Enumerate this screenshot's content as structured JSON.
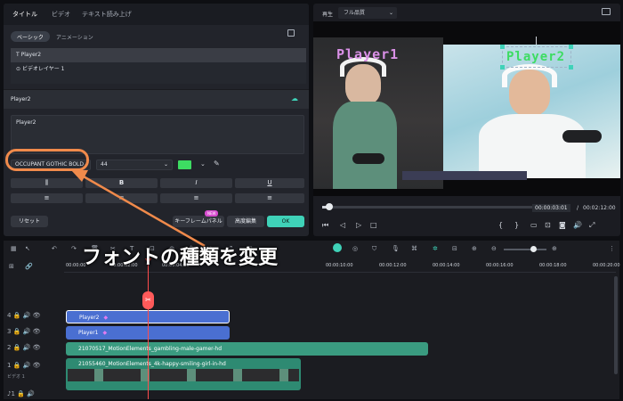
{
  "left_panel": {
    "tabs": [
      "タイトル",
      "ビデオ",
      "テキスト読み上げ"
    ],
    "subtabs": [
      "ベーシック",
      "アニメーション"
    ],
    "layers": [
      "Player2",
      "ビデオレイヤー 1"
    ],
    "section_title": "Player2",
    "text_value": "Player2",
    "font_name": "OCCUPANT GOTHIC BOLD",
    "font_size": "44",
    "format_buttons": [
      "B",
      "I",
      "U"
    ],
    "reset_label": "リセット",
    "keyframe_label": "キーフレームパネル",
    "keyframe_badge": "NEW",
    "advanced_label": "高度編集",
    "ok_label": "OK"
  },
  "preview": {
    "play_label": "再生",
    "quality_label": "フル品質",
    "overlay_left": "Player1",
    "overlay_right": "Player2",
    "current_time": "00:00:03:01",
    "separator": "/",
    "total_time": "00:02:12:00"
  },
  "timeline": {
    "ruler": [
      "00:00:00",
      "00:00:02:00",
      "00:00:04:00",
      "00:00:10:00",
      "00:00:12:00",
      "00:00:14:00",
      "00:00:16:00",
      "00:00:18:00",
      "00:00:20:00"
    ],
    "tracks": [
      {
        "label": "Player2",
        "num": "4"
      },
      {
        "label": "Player1",
        "num": "3"
      },
      {
        "label": "21070517_MotionElements_gambling-male-gamer-hd",
        "num": "2"
      },
      {
        "label": "21055460_MotionElements_4k-happy-smiling-girl-in-hd",
        "num": "1"
      }
    ],
    "video_label": "ビデオ 1",
    "audio_num": "1"
  },
  "annotation": {
    "text": "フォントの種類を変更",
    "color": "#f08a4b"
  },
  "colors": {
    "accent": "#3fd2b8",
    "title_clip": "#4a6fd1",
    "video_clip": "#3a9b80",
    "playhead": "#ff4c4c",
    "swatch": "#3ddc62"
  }
}
